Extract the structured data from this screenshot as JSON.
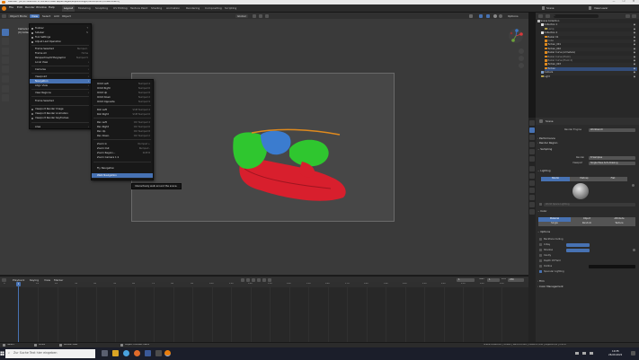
{
  "window": {
    "title": "Blender* [G:\\A collection of ancient head appendages\\Kopfanhänge\\Turban\\Anim\\Turban.blend]",
    "controls": [
      "—",
      "❐",
      "✕"
    ]
  },
  "topbar": {
    "menus": [
      "File",
      "Edit",
      "Render",
      "Window",
      "Help"
    ],
    "workspaces": [
      "Layout",
      "Modeling",
      "Sculpting",
      "UV Editing",
      "Texture Paint",
      "Shading",
      "Animation",
      "Rendering",
      "Compositing",
      "Scripting"
    ],
    "active_workspace": "Layout",
    "scene": "Scene",
    "view_layer": "View Layer"
  },
  "viewport_header": {
    "mode": "Object Mode",
    "menus": [
      "View",
      "Select",
      "Add",
      "Object"
    ],
    "active_menu": "View",
    "transform": "Global",
    "overlay_label": "Options",
    "view_name": "Camera Perspective",
    "collection": "(0) Collection | Turban"
  },
  "view_menu": {
    "items": [
      {
        "label": "Toolbar",
        "shortcut": "T",
        "check": true
      },
      {
        "label": "Sidebar",
        "shortcut": "N",
        "check": true
      },
      {
        "label": "Tool Settings",
        "shortcut": "",
        "check": true
      },
      {
        "label": "Adjust Last Operation",
        "shortcut": "",
        "check": true
      },
      {
        "label": "Frame Selected",
        "shortcut": "Numpad .",
        "check": false
      },
      {
        "label": "Frame All",
        "shortcut": "Home",
        "check": false
      },
      {
        "label": "Perspective/Orthographic",
        "shortcut": "Numpad 5",
        "check": false
      },
      {
        "label": "Local View",
        "shortcut": "",
        "check": false,
        "submenu": true
      },
      {
        "label": "Cameras",
        "shortcut": "",
        "check": false,
        "submenu": true
      },
      {
        "label": "Viewpoint",
        "shortcut": "",
        "check": false,
        "submenu": true
      },
      {
        "label": "Navigation",
        "shortcut": "",
        "check": false,
        "submenu": true
      },
      {
        "label": "Align View",
        "shortcut": "",
        "check": false,
        "submenu": true
      },
      {
        "label": "View Regions",
        "shortcut": "",
        "check": false,
        "submenu": true
      },
      {
        "label": "Frame Selected",
        "shortcut": "",
        "check": false
      },
      {
        "label": "Viewport Render Image",
        "shortcut": "",
        "check": false
      },
      {
        "label": "Viewport Render Animation",
        "shortcut": "",
        "check": false
      },
      {
        "label": "Viewport Render Keyframes",
        "shortcut": "",
        "check": false
      },
      {
        "label": "Area",
        "shortcut": "",
        "check": false,
        "submenu": true
      }
    ],
    "highlighted": "Navigation"
  },
  "nav_menu": {
    "items": [
      {
        "label": "Orbit Left",
        "shortcut": "Numpad 4"
      },
      {
        "label": "Orbit Right",
        "shortcut": "Numpad 6"
      },
      {
        "label": "Orbit Up",
        "shortcut": "Numpad 8"
      },
      {
        "label": "Orbit Down",
        "shortcut": "Numpad 2"
      },
      {
        "label": "Orbit Opposite",
        "shortcut": "Numpad 9"
      },
      {
        "label": "Roll Left",
        "shortcut": "Shift Numpad 4"
      },
      {
        "label": "Roll Right",
        "shortcut": "Shift Numpad 6"
      },
      {
        "label": "Pan Left",
        "shortcut": "Ctrl Numpad 4"
      },
      {
        "label": "Pan Right",
        "shortcut": "Ctrl Numpad 6"
      },
      {
        "label": "Pan Up",
        "shortcut": "Ctrl Numpad 8"
      },
      {
        "label": "Pan Down",
        "shortcut": "Ctrl Numpad 2"
      },
      {
        "label": "Zoom In",
        "shortcut": "Numpad +"
      },
      {
        "label": "Zoom Out",
        "shortcut": "Numpad -"
      },
      {
        "label": "Zoom Region...",
        "shortcut": "Shift B"
      },
      {
        "label": "Zoom Camera 1:1",
        "shortcut": ""
      },
      {
        "label": "Fly Navigation",
        "shortcut": ""
      },
      {
        "label": "Walk Navigation",
        "shortcut": ""
      }
    ],
    "highlighted": "Walk Navigation"
  },
  "tooltip": {
    "text": "Interactively walk around the scene."
  },
  "timeline": {
    "menus": [
      "Playback",
      "Keying",
      "View",
      "Marker"
    ],
    "ticks": [
      "0",
      "10",
      "20",
      "30",
      "40",
      "50",
      "60",
      "70",
      "80",
      "90",
      "100",
      "110",
      "120",
      "130",
      "140",
      "150",
      "160",
      "170",
      "180",
      "190",
      "200",
      "210",
      "220",
      "230",
      "240",
      "250"
    ],
    "current_frame": "1",
    "start_label": "Start",
    "start": "1",
    "end_label": "End",
    "end": "250"
  },
  "statusbar": {
    "left": [
      "Select",
      "Move",
      "Rotate View",
      "Object Context Menu"
    ],
    "right": "Scene Collection | Turban | Verts:13,442 | Faces:13,156 | Objects:1/6 | 2.93.0"
  },
  "taskbar": {
    "search_placeholder": "Zur Suche Text hier eingeben",
    "time": "10:35",
    "date": "26.09.2021"
  },
  "outliner": {
    "search_placeholder": "",
    "rows": [
      {
        "label": "Scene Collection",
        "indent": 0,
        "color": "#cfcfcf"
      },
      {
        "label": "Collection 1",
        "indent": 1,
        "color": "#cfcfcf"
      },
      {
        "label": "Lamp",
        "indent": 2,
        "color": "#9a9a9a"
      },
      {
        "label": "Collection 2",
        "indent": 1,
        "color": "#cfcfcf"
      },
      {
        "label": "Bezier 01",
        "indent": 2,
        "color": "#cfcfcf"
      },
      {
        "label": "Cube",
        "indent": 2,
        "color": "#9a9a9a"
      },
      {
        "label": "Turban_001",
        "indent": 2,
        "color": "#cfcfcf"
      },
      {
        "label": "Turban_002",
        "indent": 2,
        "color": "#cfcfcf"
      },
      {
        "label": "Bezier Curve (Armature)",
        "indent": 2,
        "color": "#cfcfcf"
      },
      {
        "label": "Bezier Curve (Hook)",
        "indent": 2,
        "color": "#9a9a9a"
      },
      {
        "label": "Bezier Curve (Hook 2)",
        "indent": 2,
        "color": "#9a9a9a"
      },
      {
        "label": "Turban_003",
        "indent": 2,
        "color": "#cfcfcf"
      },
      {
        "label": "Turban",
        "indent": 2,
        "color": "#cfcfcf"
      },
      {
        "label": "Camera",
        "indent": 1,
        "color": "#cfcfcf"
      },
      {
        "label": "Light",
        "indent": 1,
        "color": "#cfcfcf"
      }
    ]
  },
  "properties": {
    "scene_name": "Scene",
    "render_engine_label": "Render Engine",
    "render_engine": "Workbench",
    "sections": [
      "Performance",
      "Render Region",
      "Sampling",
      "Lighting",
      "Color",
      "Options",
      "Film",
      "Color Management"
    ],
    "aa_label": "Render",
    "aa_value": "8 Samples",
    "viewport_label": "Viewport",
    "viewport_value": "Single Pass Anti-Aliasing",
    "lighting_tabs": [
      "Studio",
      "Matcap",
      "Flat"
    ],
    "lighting_active": "Studio",
    "world_space_label": "World Space Lighting",
    "color_tabs": [
      "Material",
      "Object",
      "Attribute",
      "Single",
      "Random",
      "Texture"
    ],
    "color_active": "Material",
    "options": [
      {
        "label": "Backface Culling",
        "on": false
      },
      {
        "label": "X-Ray",
        "on": false
      },
      {
        "label": "Shadow",
        "on": false
      },
      {
        "label": "Cavity",
        "on": false
      },
      {
        "label": "Depth Of Field",
        "on": false
      },
      {
        "label": "Outline",
        "on": false
      },
      {
        "label": "Specular Lighting",
        "on": true
      }
    ]
  },
  "colors": {
    "accent": "#4772b3",
    "mesh_green": "#2fc62f",
    "mesh_red": "#d81f2d",
    "mesh_blue": "#3b7ccf",
    "mesh_orange": "#e08a1d"
  }
}
